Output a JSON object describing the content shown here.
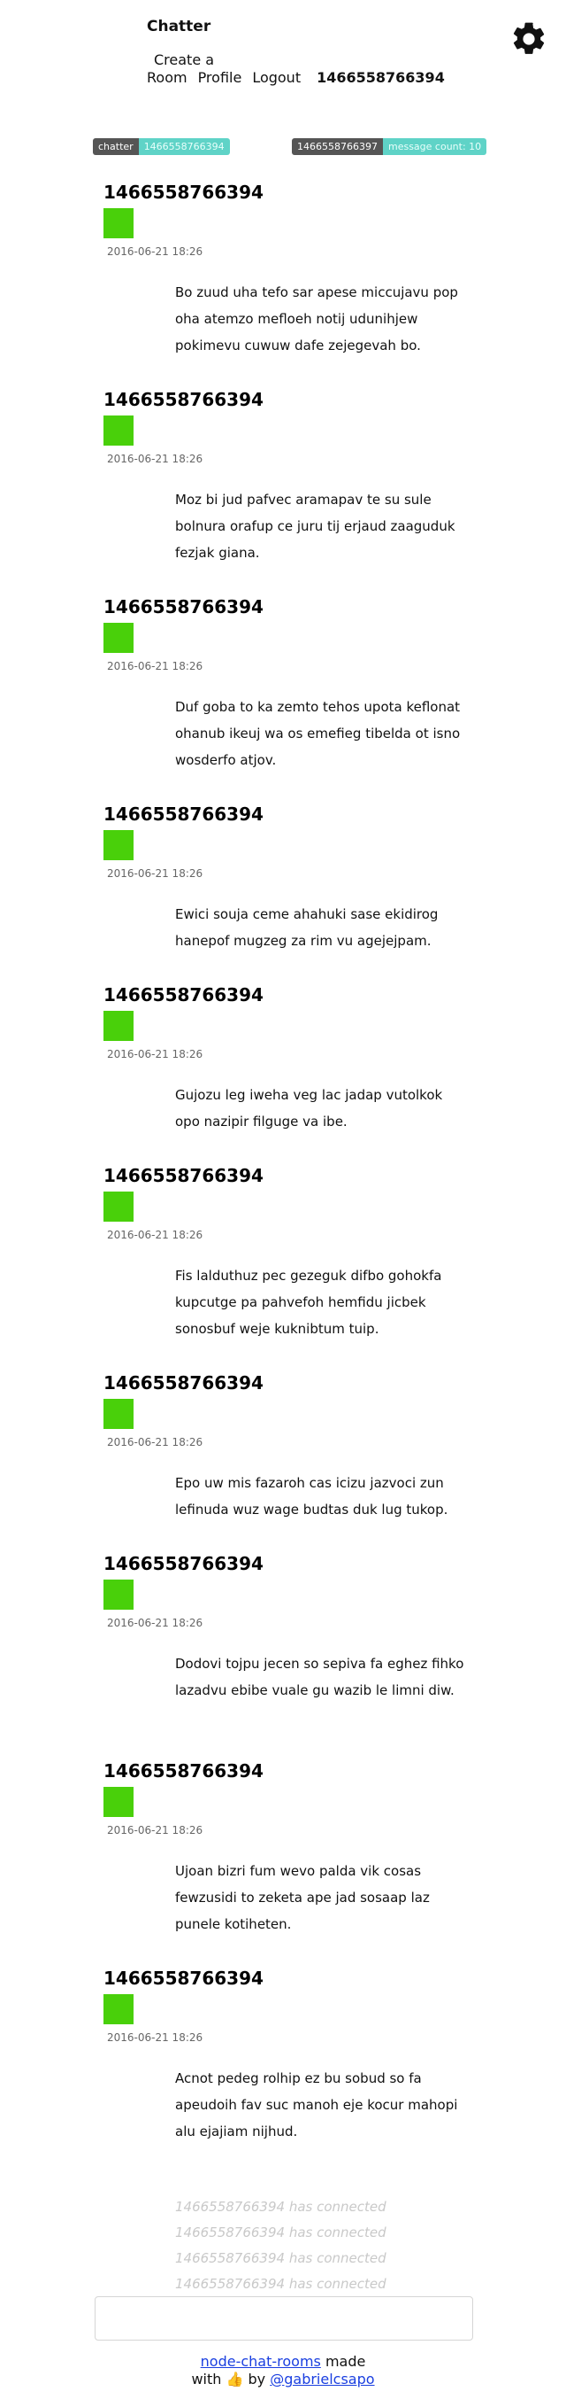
{
  "header": {
    "brand": "Chatter",
    "nav": {
      "create_room_line1": "Create a",
      "create_room_line2": "Room",
      "profile": "Profile",
      "logout": "Logout",
      "username": "1466558766394"
    },
    "settings_icon": "gear-icon"
  },
  "badges": [
    {
      "key": "chatter",
      "value": "1466558766394"
    },
    {
      "key": "1466558766397",
      "value": "message count: 10"
    }
  ],
  "messages": [
    {
      "author": "1466558766394",
      "time": "2016-06-21 18:26",
      "text": "Bo zuud uha tefo sar apese miccujavu pop oha atemzo mefloeh notij udunihjew pokimevu cuwuw dafe zejegevah bo."
    },
    {
      "author": "1466558766394",
      "time": "2016-06-21 18:26",
      "text": "Moz bi jud pafvec aramapav te su sule bolnura orafup ce juru tij erjaud zaaguduk fezjak giana."
    },
    {
      "author": "1466558766394",
      "time": "2016-06-21 18:26",
      "text": "Duf goba to ka zemto tehos upota keflonat ohanub ikeuj wa os emefieg tibelda ot isno wosderfo atjov."
    },
    {
      "author": "1466558766394",
      "time": "2016-06-21 18:26",
      "text": "Ewici souja ceme ahahuki sase ekidirog hanepof mugzeg za rim vu agejejpam."
    },
    {
      "author": "1466558766394",
      "time": "2016-06-21 18:26",
      "text": "Gujozu leg iweha veg lac jadap vutolkok opo nazipir filguge va ibe."
    },
    {
      "author": "1466558766394",
      "time": "2016-06-21 18:26",
      "text": "Fis lalduthuz pec gezeguk difbo gohokfa kupcutge pa pahvefoh hemfidu jicbek sonosbuf weje kuknibtum tuip."
    },
    {
      "author": "1466558766394",
      "time": "2016-06-21 18:26",
      "text": "Epo uw mis fazaroh cas icizu jazvoci zun lefinuda wuz wage budtas duk lug tukop."
    },
    {
      "author": "1466558766394",
      "time": "2016-06-21 18:26",
      "text": "Dodovi tojpu jecen so sepiva fa eghez fihko lazadvu ebibe vuale gu wazib le limni diw."
    },
    {
      "author": "1466558766394",
      "time": "2016-06-21 18:26",
      "text": "Ujoan bizri fum wevo palda vik cosas fewzusidi to zeketa ape jad sosaap laz punele kotiheten."
    },
    {
      "author": "1466558766394",
      "time": "2016-06-21 18:26",
      "text": "Acnot pedeg rolhip ez bu sobud so fa apeudoih fav suc manoh eje kocur mahopi alu ejajiam nijhud."
    }
  ],
  "notifications": [
    "1466558766394 has connected",
    "1466558766394 has connected",
    "1466558766394 has connected",
    "1466558766394 has connected"
  ],
  "composer": {
    "placeholder": ""
  },
  "footer": {
    "link": "node-chat-rooms",
    "made": "made",
    "with": "with",
    "emoji": "👍",
    "by": "by",
    "author_link": "@gabrielcsapo"
  },
  "colors": {
    "avatar": "#49d00a",
    "badge_key_bg": "#555555",
    "badge_value_bg": "#5fd3c7",
    "link": "#1a3fe0",
    "notification_text": "#c9c9c9"
  }
}
